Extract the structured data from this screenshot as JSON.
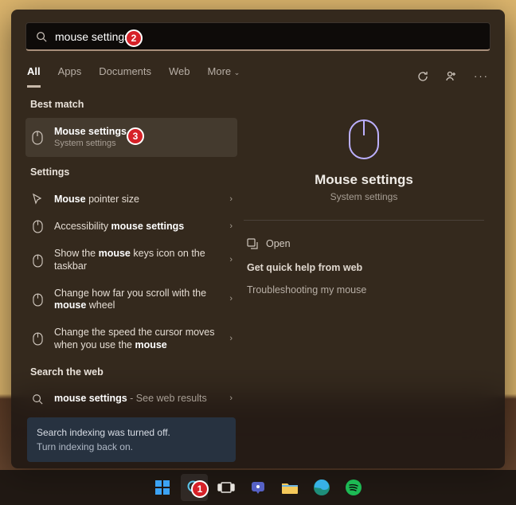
{
  "search": {
    "value": "mouse settings"
  },
  "tabs": [
    "All",
    "Apps",
    "Documents",
    "Web",
    "More"
  ],
  "sections": {
    "bestMatch": "Best match",
    "settings": "Settings",
    "searchWeb": "Search the web"
  },
  "best": {
    "title": "Mouse settings",
    "sub": "System settings"
  },
  "settingsItems": [
    {
      "pre": "",
      "b": "Mouse",
      "post": " pointer size"
    },
    {
      "pre": "Accessibility ",
      "b": "mouse settings",
      "post": ""
    },
    {
      "pre": "Show the ",
      "b": "mouse",
      "post": " keys icon on the taskbar"
    },
    {
      "pre": "Change how far you scroll with the ",
      "b": "mouse",
      "post": " wheel"
    },
    {
      "pre": "Change the speed the cursor moves when you use the ",
      "b": "mouse",
      "post": ""
    }
  ],
  "webItem": {
    "b": "mouse settings",
    "post": " - See web results"
  },
  "notice": {
    "line1": "Search indexing was turned off.",
    "line2": "Turn indexing back on."
  },
  "detail": {
    "title": "Mouse settings",
    "sub": "System settings",
    "open": "Open",
    "helpHead": "Get quick help from web",
    "help1": "Troubleshooting my mouse"
  },
  "badges": {
    "b1": "1",
    "b2": "2",
    "b3": "3"
  }
}
